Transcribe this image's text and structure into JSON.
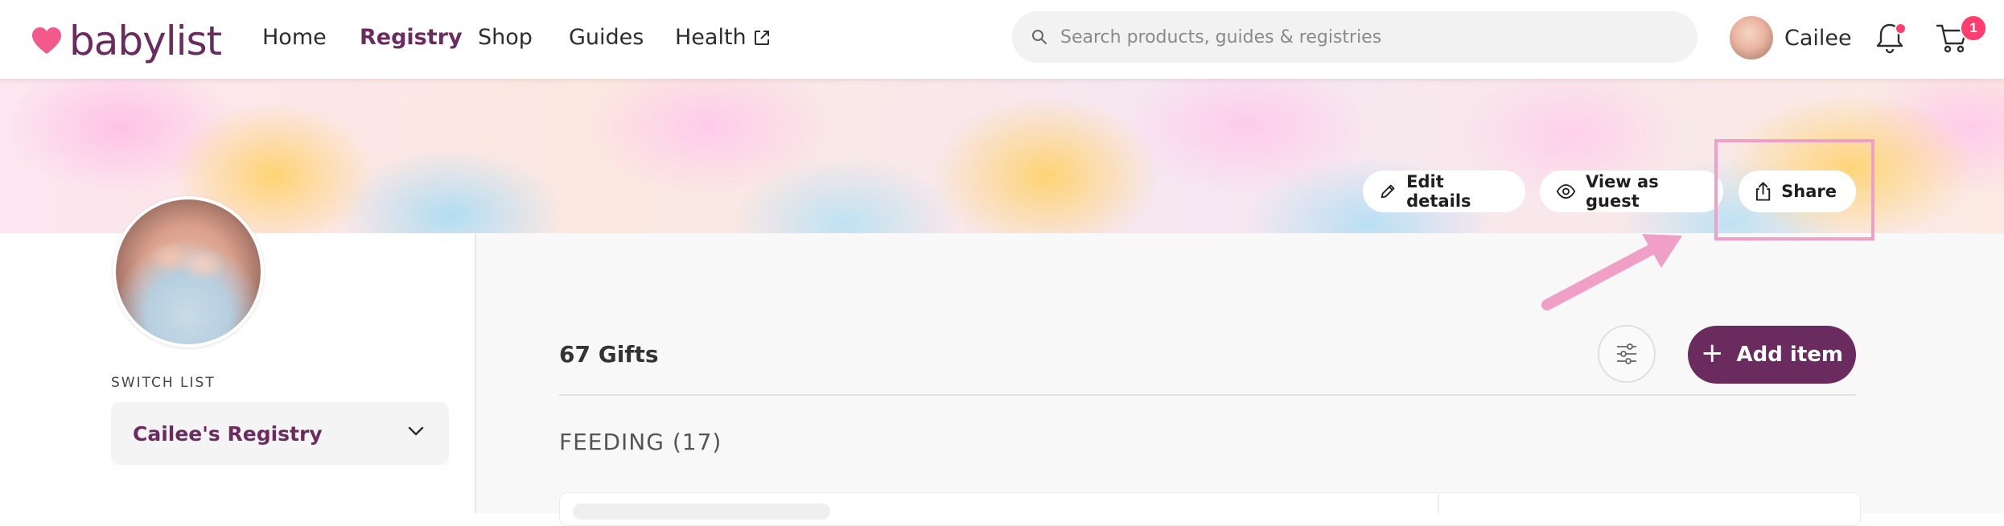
{
  "nav": {
    "logo_text": "babylist",
    "links": [
      {
        "label": "Home"
      },
      {
        "label": "Registry"
      },
      {
        "label": "Shop"
      },
      {
        "label": "Guides"
      },
      {
        "label": "Health"
      }
    ],
    "active_link": "Registry",
    "search_placeholder": "Search products, guides & registries",
    "user_name": "Cailee",
    "cart_count": "1"
  },
  "banner": {
    "buttons": {
      "edit": "Edit details",
      "view_guest": "View as guest",
      "share": "Share"
    }
  },
  "sidebar": {
    "switch_list_label": "SWITCH LIST",
    "selected_list": "Cailee's Registry"
  },
  "main": {
    "gifts_count": "67 Gifts",
    "add_item_label": "Add item",
    "category_heading": "FEEDING (17)"
  },
  "colors": {
    "brand_purple": "#6a2c5e",
    "logo_heart": "#f25a8c",
    "annotation_pink": "#f0a0c6",
    "notification": "#ff3d6e"
  }
}
